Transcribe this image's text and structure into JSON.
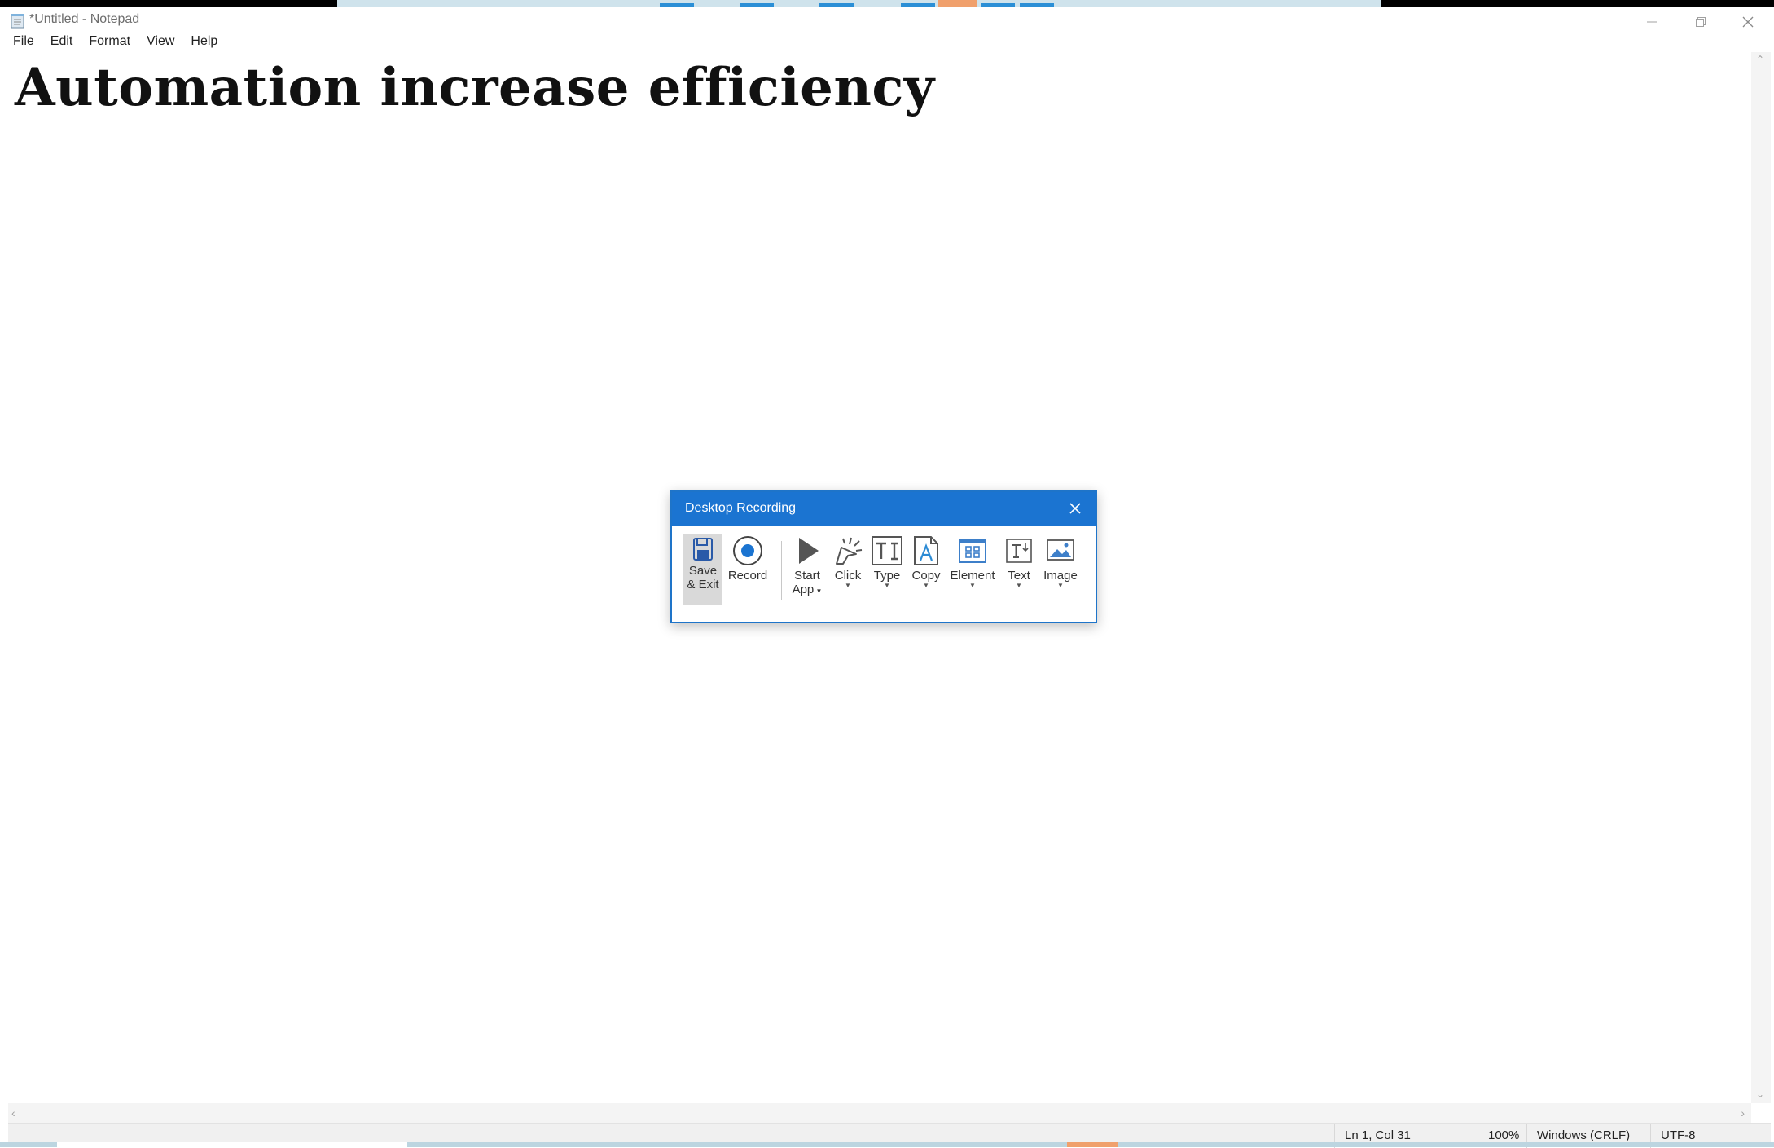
{
  "window": {
    "title": "*Untitled - Notepad",
    "icon": "notepad-icon",
    "controls": [
      "minimize-icon",
      "restore-icon",
      "close-icon"
    ]
  },
  "menu": {
    "file": "File",
    "edit": "Edit",
    "format": "Format",
    "view": "View",
    "help": "Help"
  },
  "editor": {
    "text": "Automation increase efficiency"
  },
  "status": {
    "position": "Ln 1, Col 31",
    "zoom": "100%",
    "line_ending": "Windows (CRLF)",
    "encoding": "UTF-8"
  },
  "dialog": {
    "title": "Desktop Recording",
    "accent": "#1b74d1",
    "tools": {
      "save_line1": "Save",
      "save_line2": "& Exit",
      "record": "Record",
      "start_line1": "Start",
      "start_line2": "App",
      "click": "Click",
      "type": "Type",
      "copy": "Copy",
      "element": "Element",
      "text": "Text",
      "image": "Image"
    }
  }
}
